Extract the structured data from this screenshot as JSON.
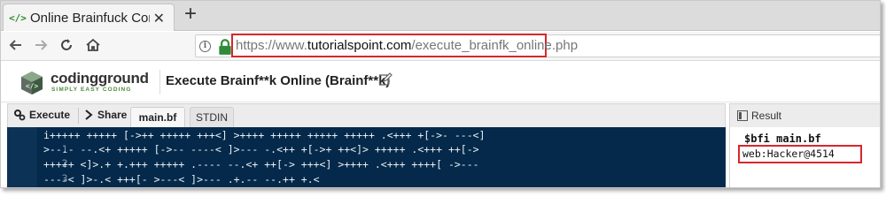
{
  "browser": {
    "tab_title": "Online Brainfuck Compile",
    "tab_favicon": "</>",
    "close_glyph": "✕",
    "newtab_glyph": "+",
    "url_prefix": "https://www.",
    "url_domain": "tutorialspoint.com",
    "url_path": "/execute_brainfk_online.php"
  },
  "header": {
    "logo_name": "codingground",
    "logo_tagline": "SIMPLY EASY CODING",
    "title": "Execute Brainf**k Online (Brainf**k)"
  },
  "toolbar": {
    "execute_label": "Execute",
    "share_label": "Share",
    "tabs": [
      "main.bf",
      "STDIN"
    ]
  },
  "editor": {
    "lines": [
      {
        "n": "1",
        "code": "i+++++ +++++ [->++ +++++ +++<] >++++ +++++ +++++ +++++ .<+++ +[->- ---<]"
      },
      {
        "n": "2",
        "code": ">--.- --.<+ +++++ [->-- ----< ]>--- -.<++ +[->+ ++<]> +++++ .<+++ ++[->"
      },
      {
        "n": "3",
        "code": "+++++ <]>.+ +.+++ +++++ .---- --.<+ ++[-> +++<] >++++ .<+++ ++++[ ->---"
      },
      {
        "n": "4",
        "code": "----< ]>-.< +++[- >---< ]>--- .+.-- --.++ +.<"
      }
    ]
  },
  "result": {
    "label": "Result",
    "command": "$bfi main.bf",
    "output": "web:Hacker@4514"
  },
  "colors": {
    "highlight_border": "#d9262c",
    "editor_bg": "#04294a",
    "brand_green": "#4e8a3e"
  }
}
